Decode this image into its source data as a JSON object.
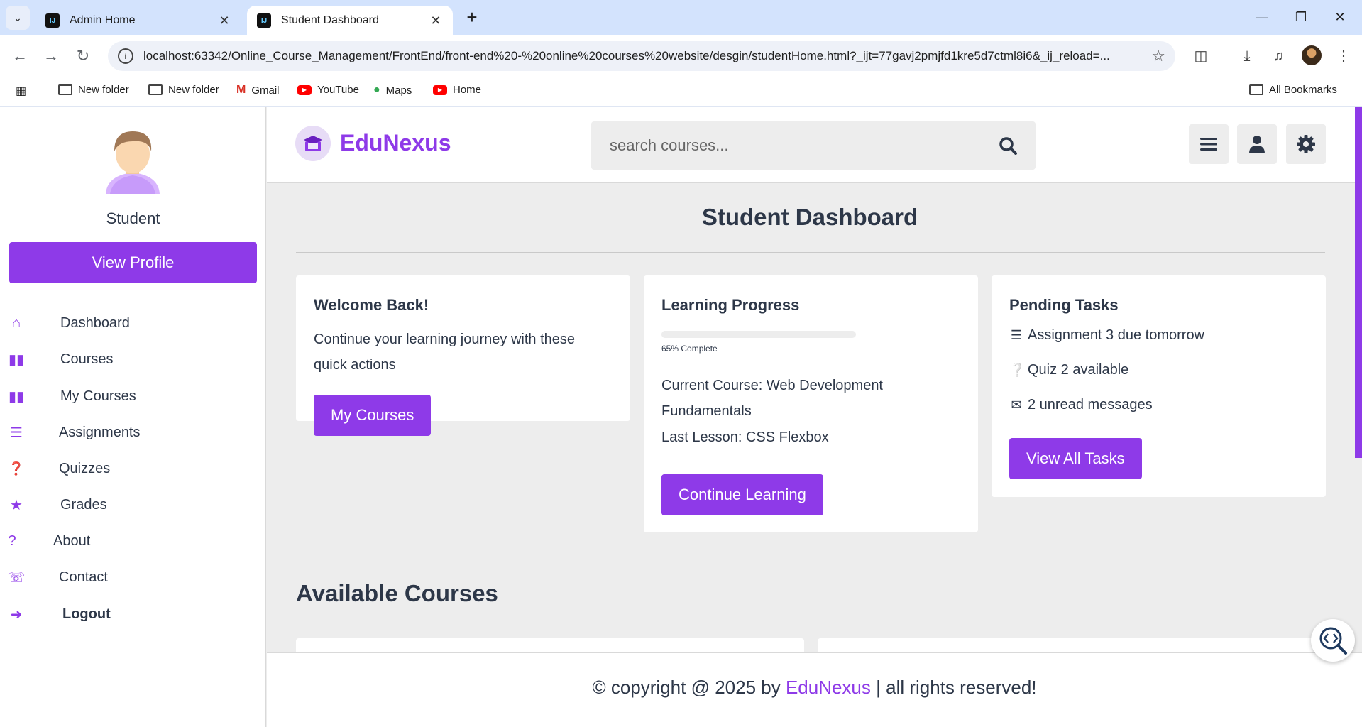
{
  "browser": {
    "tabs": [
      {
        "title": "Admin Home",
        "active": false
      },
      {
        "title": "Student Dashboard",
        "active": true
      }
    ],
    "url": "localhost:63342/Online_Course_Management/FrontEnd/front-end%20-%20online%20courses%20website/desgin/studentHome.html?_ijt=77gavj2pmjfd1kre5d7ctml8i6&_ij_reload=...",
    "bookmarks": [
      {
        "label": "New folder",
        "icon": "folder-icon"
      },
      {
        "label": "New folder",
        "icon": "folder-icon"
      },
      {
        "label": "Gmail",
        "icon": "gmail-icon"
      },
      {
        "label": "YouTube",
        "icon": "youtube-icon"
      },
      {
        "label": "Maps",
        "icon": "maps-icon"
      },
      {
        "label": "Home",
        "icon": "youtube-icon"
      }
    ],
    "all_bookmarks": "All Bookmarks"
  },
  "sidebar": {
    "profile_name": "Student",
    "view_profile_label": "View Profile",
    "items": [
      {
        "label": "Dashboard",
        "icon": "home-icon"
      },
      {
        "label": "Courses",
        "icon": "book-icon"
      },
      {
        "label": "My Courses",
        "icon": "book-icon"
      },
      {
        "label": "Assignments",
        "icon": "list-check-icon"
      },
      {
        "label": "Quizzes",
        "icon": "question-circle-icon"
      },
      {
        "label": "Grades",
        "icon": "star-icon"
      },
      {
        "label": "About",
        "icon": "question-icon"
      },
      {
        "label": "Contact",
        "icon": "headset-icon"
      },
      {
        "label": "Logout",
        "icon": "logout-icon"
      }
    ]
  },
  "header": {
    "logo_text": "EduNexus",
    "search_placeholder": "search courses..."
  },
  "main": {
    "title": "Student Dashboard",
    "welcome": {
      "title": "Welcome Back!",
      "text": "Continue your learning journey with these quick actions",
      "button": "My Courses"
    },
    "progress": {
      "title": "Learning Progress",
      "percent": 65,
      "label": "65% Complete",
      "current_course": "Current Course: Web Development Fundamentals",
      "last_lesson": "Last Lesson: CSS Flexbox",
      "button": "Continue Learning"
    },
    "tasks": {
      "title": "Pending Tasks",
      "items": [
        {
          "text": "Assignment 3 due tomorrow",
          "icon": "list-check-icon"
        },
        {
          "text": "Quiz 2 available",
          "icon": "question-circle-icon"
        },
        {
          "text": "2 unread messages",
          "icon": "envelope-icon"
        }
      ],
      "button": "View All Tasks"
    },
    "available_courses_title": "Available Courses"
  },
  "footer": {
    "prefix": "© copyright @ 2025 by ",
    "brand": "EduNexus",
    "suffix": " | all rights reserved!"
  },
  "colors": {
    "accent": "#8e3ae8",
    "text": "#2d3748",
    "background": "#ededed"
  }
}
